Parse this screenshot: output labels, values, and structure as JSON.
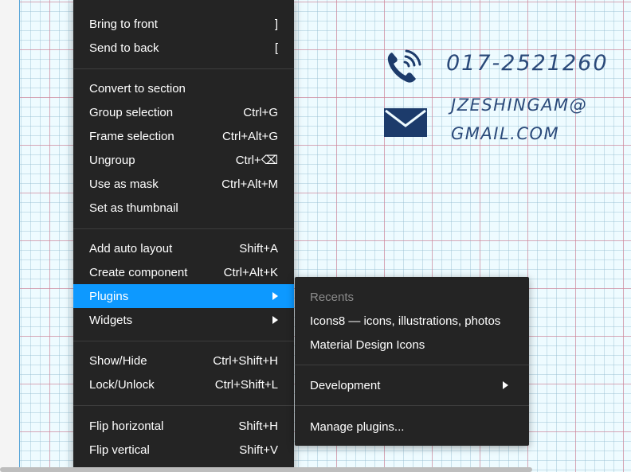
{
  "canvas": {
    "phone": "017-2521260",
    "email_line1": "JZESHINGAM@",
    "email_line2": "GMAIL.COM",
    "icons": [
      "phone-icon",
      "mail-icon"
    ],
    "text_color": "#2b4a7a"
  },
  "context_menu": {
    "bring_to_front": {
      "label": "Bring to front",
      "shortcut": "]"
    },
    "send_to_back": {
      "label": "Send to back",
      "shortcut": "["
    },
    "convert_to_section": {
      "label": "Convert to section",
      "shortcut": ""
    },
    "group_selection": {
      "label": "Group selection",
      "shortcut": "Ctrl+G"
    },
    "frame_selection": {
      "label": "Frame selection",
      "shortcut": "Ctrl+Alt+G"
    },
    "ungroup": {
      "label": "Ungroup",
      "shortcut": "Ctrl+⌫"
    },
    "use_as_mask": {
      "label": "Use as mask",
      "shortcut": "Ctrl+Alt+M"
    },
    "set_as_thumbnail": {
      "label": "Set as thumbnail",
      "shortcut": ""
    },
    "add_auto_layout": {
      "label": "Add auto layout",
      "shortcut": "Shift+A"
    },
    "create_component": {
      "label": "Create component",
      "shortcut": "Ctrl+Alt+K"
    },
    "plugins": {
      "label": "Plugins"
    },
    "widgets": {
      "label": "Widgets"
    },
    "show_hide": {
      "label": "Show/Hide",
      "shortcut": "Ctrl+Shift+H"
    },
    "lock_unlock": {
      "label": "Lock/Unlock",
      "shortcut": "Ctrl+Shift+L"
    },
    "flip_horizontal": {
      "label": "Flip horizontal",
      "shortcut": "Shift+H"
    },
    "flip_vertical": {
      "label": "Flip vertical",
      "shortcut": "Shift+V"
    },
    "highlight_color": "#0d99ff"
  },
  "plugins_submenu": {
    "recents_header": "Recents",
    "icons8": "Icons8 — icons, illustrations, photos",
    "material_design_icons": "Material Design Icons",
    "development": "Development",
    "manage_plugins": "Manage plugins..."
  }
}
